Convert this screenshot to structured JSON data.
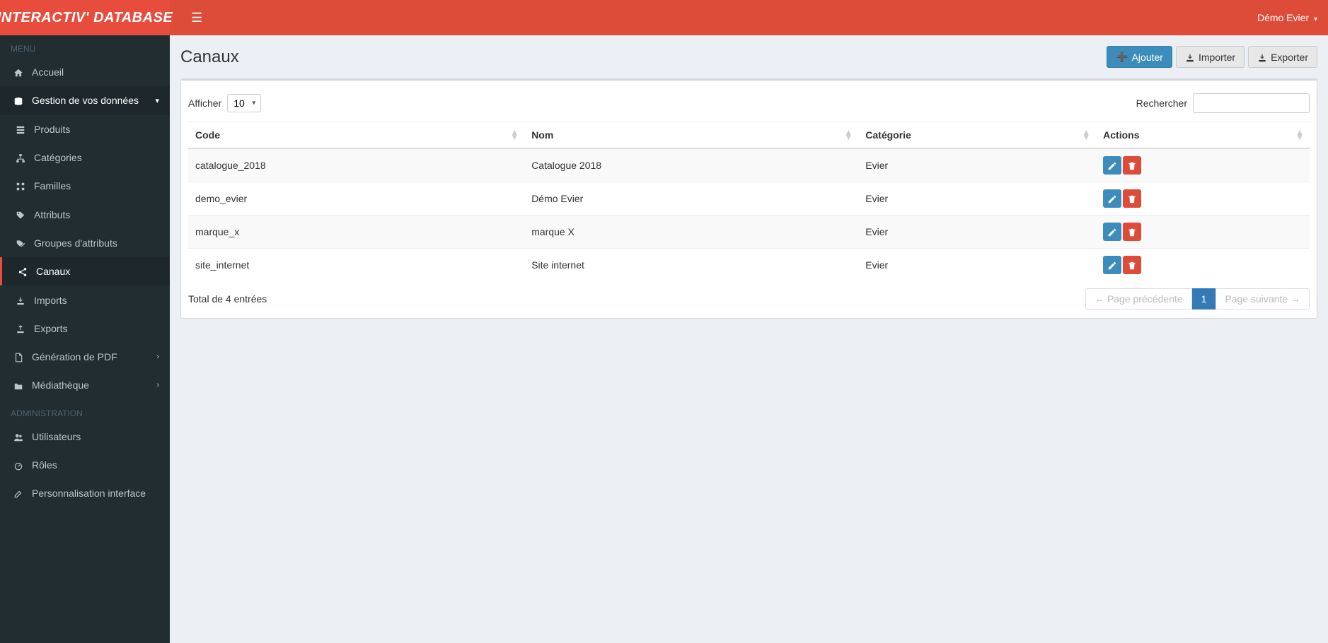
{
  "brand": {
    "part1": "INTERACTIV'",
    "part2": "DATABASE"
  },
  "user": {
    "name": "Démo Evier"
  },
  "sidebar": {
    "section_menu": "MENU",
    "section_admin": "ADMINISTRATION",
    "items": [
      {
        "label": "Accueil",
        "icon": "home"
      },
      {
        "label": "Gestion de vos données",
        "icon": "database",
        "expandable": true,
        "expanded": true
      },
      {
        "label": "Produits",
        "icon": "list",
        "sub": true
      },
      {
        "label": "Catégories",
        "icon": "sitemap",
        "sub": true
      },
      {
        "label": "Familles",
        "icon": "tree",
        "sub": true
      },
      {
        "label": "Attributs",
        "icon": "tags",
        "sub": true
      },
      {
        "label": "Groupes d'attributs",
        "icon": "tags",
        "sub": true
      },
      {
        "label": "Canaux",
        "icon": "share",
        "sub": true,
        "active": true
      },
      {
        "label": "Imports",
        "icon": "download",
        "sub": true
      },
      {
        "label": "Exports",
        "icon": "upload",
        "sub": true
      },
      {
        "label": "Génération de PDF",
        "icon": "pdf",
        "expandable": true
      },
      {
        "label": "Médiathèque",
        "icon": "folder",
        "expandable": true
      }
    ],
    "admin_items": [
      {
        "label": "Utilisateurs",
        "icon": "users"
      },
      {
        "label": "Rôles",
        "icon": "dashboard"
      },
      {
        "label": "Personnalisation interface",
        "icon": "edit"
      }
    ]
  },
  "page": {
    "title": "Canaux",
    "actions": {
      "add": "Ajouter",
      "import": "Importer",
      "export": "Exporter"
    },
    "table_controls": {
      "show_label": "Afficher",
      "show_value": "10",
      "search_label": "Rechercher"
    },
    "columns": {
      "code": "Code",
      "name": "Nom",
      "category": "Catégorie",
      "actions": "Actions"
    },
    "rows": [
      {
        "code": "catalogue_2018",
        "name": "Catalogue 2018",
        "category": "Evier"
      },
      {
        "code": "demo_evier",
        "name": "Démo Evier",
        "category": "Evier"
      },
      {
        "code": "marque_x",
        "name": "marque X",
        "category": "Evier"
      },
      {
        "code": "site_internet",
        "name": "Site internet",
        "category": "Evier"
      }
    ],
    "footer": {
      "total_text": "Total de 4 entrées",
      "prev": "Page précédente",
      "next": "Page suivante",
      "current_page": "1"
    }
  }
}
